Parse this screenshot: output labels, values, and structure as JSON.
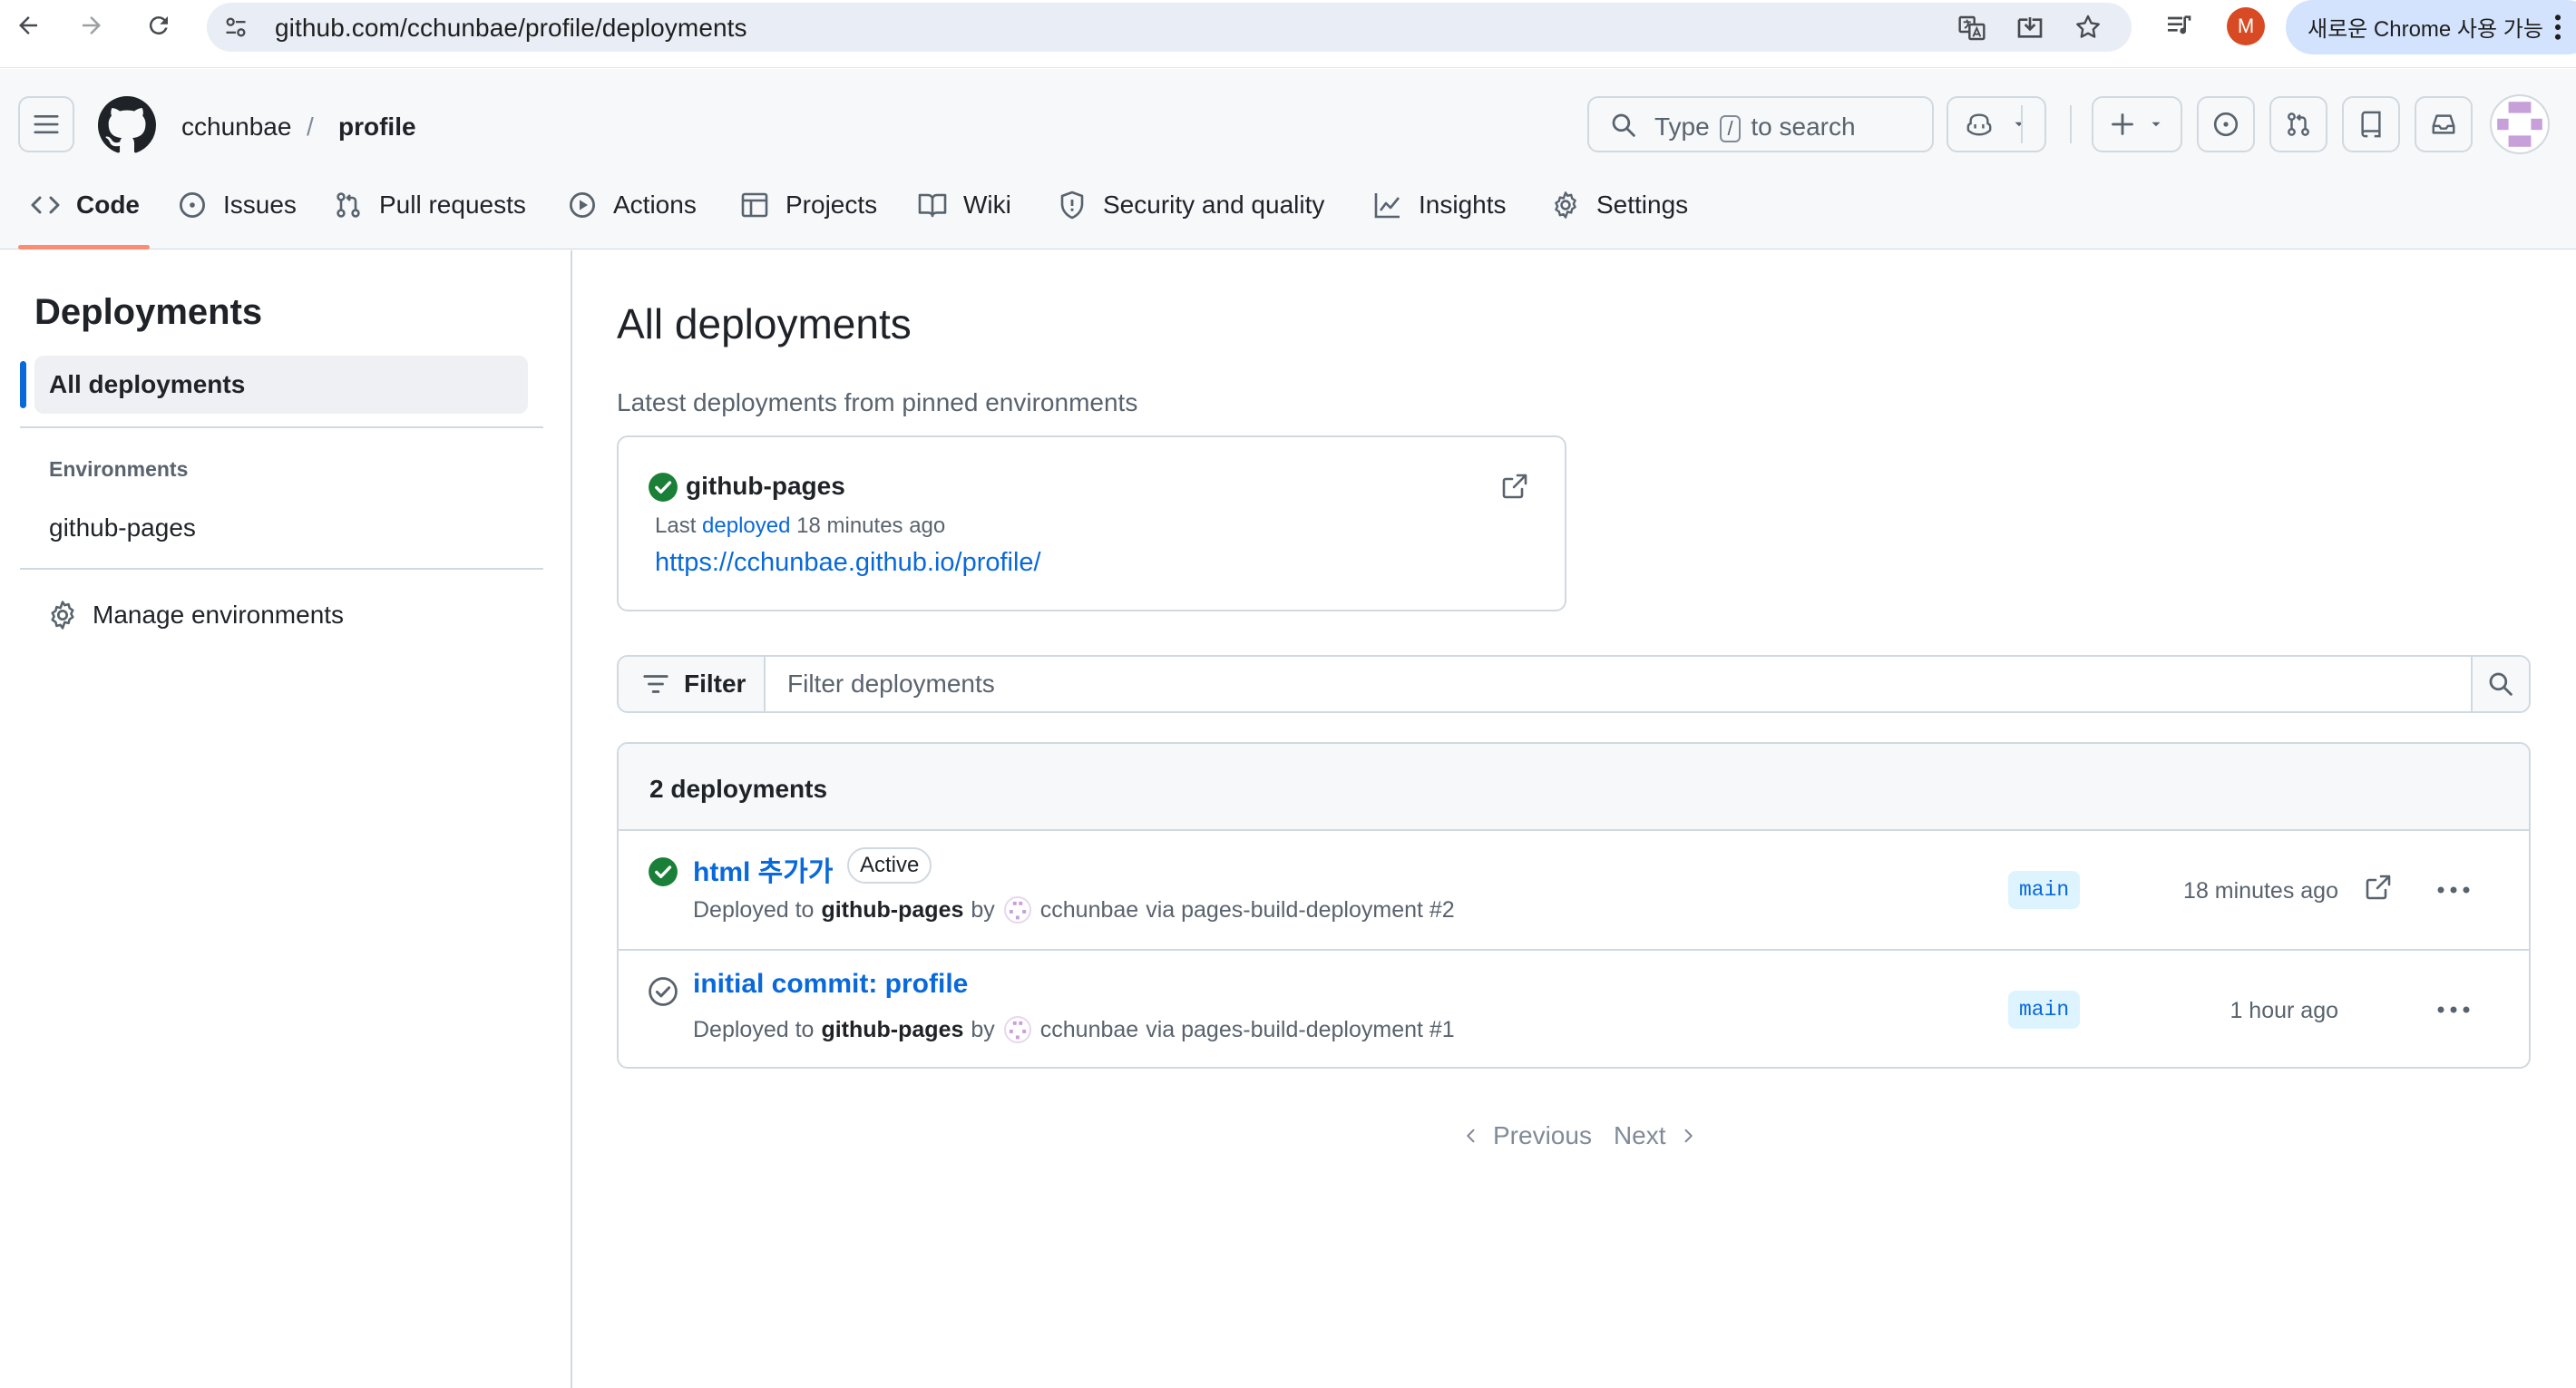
{
  "browser": {
    "url": "github.com/cchunbae/profile/deployments",
    "promo_text": "새로운 Chrome 사용 가능",
    "profile_initial": "M"
  },
  "header": {
    "owner": "cchunbae",
    "separator": "/",
    "repo": "profile",
    "search_prefix": "Type",
    "search_key": "/",
    "search_suffix": "to search"
  },
  "tabs": [
    {
      "label": "Code",
      "icon": "code-icon"
    },
    {
      "label": "Issues",
      "icon": "issue-opened-icon"
    },
    {
      "label": "Pull requests",
      "icon": "git-pull-request-icon"
    },
    {
      "label": "Actions",
      "icon": "play-icon"
    },
    {
      "label": "Projects",
      "icon": "table-icon"
    },
    {
      "label": "Wiki",
      "icon": "book-icon"
    },
    {
      "label": "Security and quality",
      "icon": "shield-icon"
    },
    {
      "label": "Insights",
      "icon": "graph-icon"
    },
    {
      "label": "Settings",
      "icon": "gear-icon"
    }
  ],
  "sidebar": {
    "title": "Deployments",
    "all_label": "All deployments",
    "environments_heading": "Environments",
    "environments": [
      "github-pages"
    ],
    "manage_label": "Manage environments"
  },
  "main": {
    "title": "All deployments",
    "pinned_subtitle": "Latest deployments from pinned environments",
    "pinned_env": {
      "name": "github-pages",
      "meta_prefix": "Last",
      "meta_link": "deployed",
      "meta_suffix": "18 minutes ago",
      "url": "https://cchunbae.github.io/profile/"
    },
    "filter": {
      "button_label": "Filter",
      "placeholder": "Filter deployments"
    },
    "list": {
      "count_label": "2 deployments",
      "rows": [
        {
          "title": "html 추가가",
          "badge": "Active",
          "deployed_to_text": "Deployed to",
          "environment": "github-pages",
          "by_text": "by",
          "user": "cchunbae",
          "via_text": "via pages-build-deployment #2",
          "branch": "main",
          "time": "18 minutes ago",
          "status": "success"
        },
        {
          "title": "initial commit: profile",
          "badge": "",
          "deployed_to_text": "Deployed to",
          "environment": "github-pages",
          "by_text": "by",
          "user": "cchunbae",
          "via_text": "via pages-build-deployment #1",
          "branch": "main",
          "time": "1 hour ago",
          "status": "inactive"
        }
      ]
    },
    "pagination": {
      "previous": "Previous",
      "next": "Next"
    }
  },
  "colors": {
    "accent": "#0969da",
    "success": "#1a7f37",
    "tab_underline": "#fd8c73",
    "chrome_avatar": "#d84a24"
  }
}
